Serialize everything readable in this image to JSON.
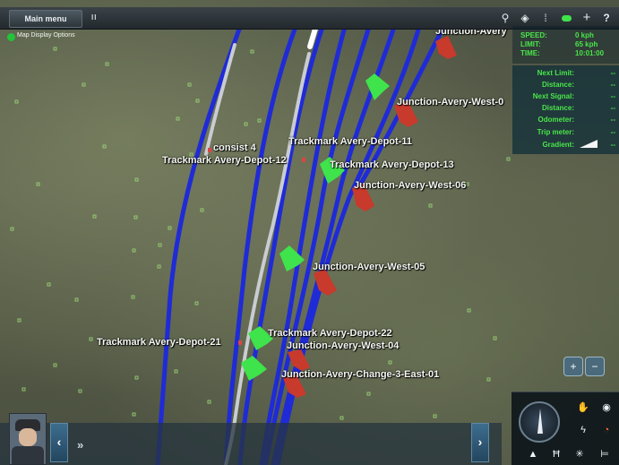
{
  "top_bar": {
    "main_menu_label": "Main menu",
    "pause_label": "II",
    "icons": [
      "pin-icon",
      "view-icon",
      "signal-icon",
      "cloud-icon",
      "plus-icon",
      "help-icon"
    ],
    "help_label": "?"
  },
  "map_display_options": {
    "label": "Map Display Options",
    "indicator_color": "#22c43a"
  },
  "speed_panel": {
    "speed_label": "SPEED:",
    "speed_value": "0 kph",
    "limit_label": "LIMIT:",
    "limit_value": "65 kph",
    "time_label": "TIME:",
    "time_value": "10:01:00"
  },
  "info_panel": {
    "rows": [
      {
        "label": "Next Limit:",
        "value": "--"
      },
      {
        "label": "Distance:",
        "value": "--"
      },
      {
        "label": "Next Signal:",
        "value": "--"
      },
      {
        "label": "Distance:",
        "value": "--"
      },
      {
        "label": "Odometer:",
        "value": "--"
      },
      {
        "label": "Trip meter:",
        "value": "--"
      },
      {
        "label": "Gradient:",
        "value": "--"
      }
    ]
  },
  "map_labels": {
    "junction_avery_top": "Junction-Avery",
    "junction_avery_west_07": "Junction-Avery-West-0",
    "consist": "consist 4",
    "trackmark_depot_11": "Trackmark Avery-Depot-11",
    "trackmark_depot_12": "Trackmark Avery-Depot-12",
    "trackmark_depot_13": "Trackmark Avery-Depot-13",
    "junction_avery_west_06": "Junction-Avery-West-06",
    "junction_avery_west_05": "Junction-Avery-West-05",
    "trackmark_depot_22": "Trackmark Avery-Depot-22",
    "trackmark_depot_21": "Trackmark Avery-Depot-21",
    "junction_avery_west_04": "Junction-Avery-West-04",
    "junction_avery_change": "Junction-Avery-Change-3-East-01"
  },
  "zoom": {
    "zoom_in_label": "+",
    "zoom_out_label": "−"
  },
  "bottom_bar": {
    "prev_label": "‹",
    "next_label": "›",
    "expand_label": "»"
  },
  "colors": {
    "track": "#1f2bd6",
    "train": "#c9ccd2",
    "signal_green": "#3fe34b",
    "signal_red": "#c73a2c",
    "hud_text": "#49e54a"
  }
}
